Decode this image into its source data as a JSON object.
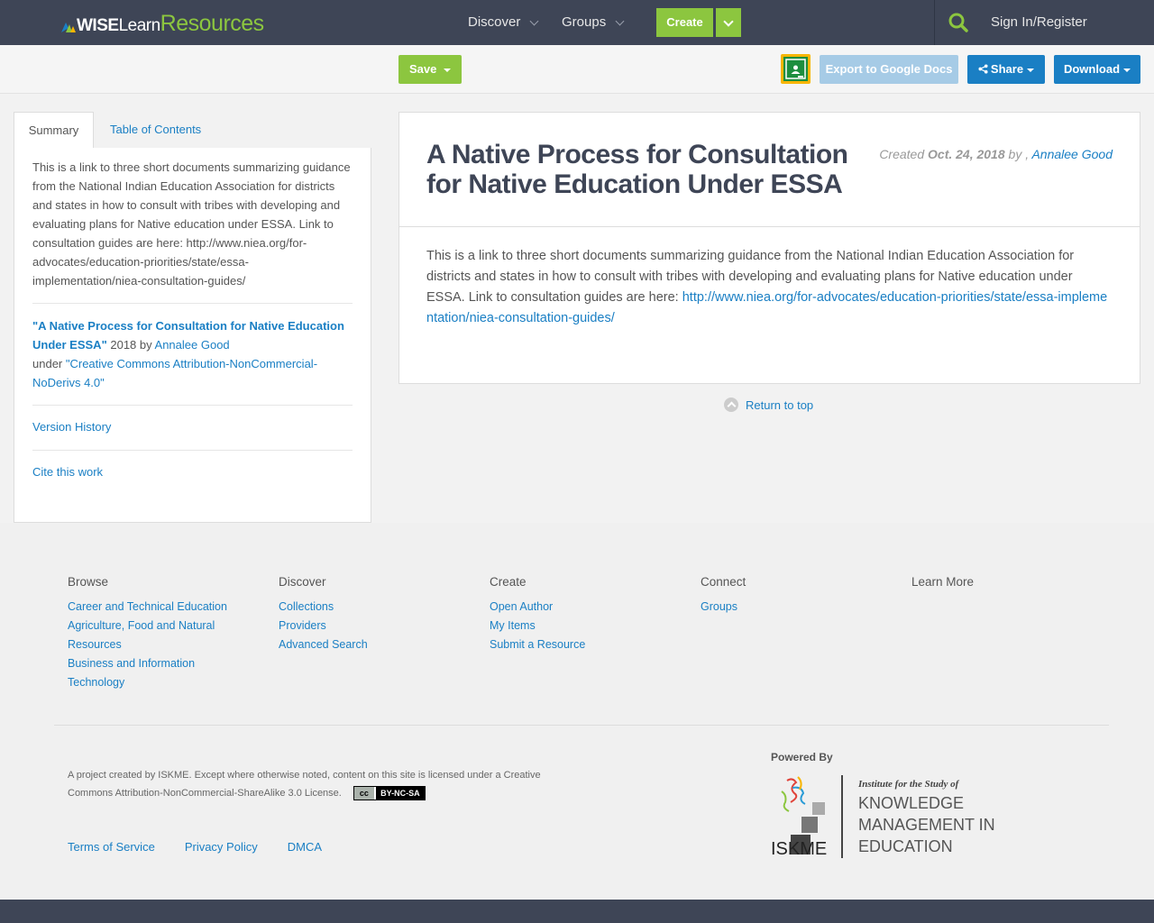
{
  "brand": {
    "wise": "WISE",
    "learn": "Learn",
    "resources": "Resources"
  },
  "nav": {
    "discover": "Discover",
    "groups": "Groups",
    "create": "Create",
    "sign_in": "Sign In/Register"
  },
  "actions": {
    "save": "Save",
    "export": "Export to Google Docs",
    "share": "Share",
    "download": "Download"
  },
  "sidebar": {
    "tabs": [
      "Summary",
      "Table of Contents"
    ],
    "summary": "This is a link to three short documents summarizing guidance from the National Indian Education Association for districts and states in how to consult with tribes with developing and evaluating plans for Native education under ESSA. Link to consultation guides are here: http://www.niea.org/for-advocates/education-priorities/state/essa-implementation/niea-consultation-guides/",
    "attribution": {
      "title": "\"A Native Process for Consultation for Native Education Under ESSA\"",
      "year_by": " 2018 by ",
      "author": "Annalee Good",
      "under": "under ",
      "license": "\"Creative Commons Attribution-NonCommercial-NoDerivs 4.0\""
    },
    "version_history": "Version History",
    "cite": "Cite this work"
  },
  "main": {
    "title": "A Native Process for Consultation for Native Education Under ESSA",
    "created_label": "Created ",
    "created_date": "Oct. 24, 2018",
    "by": " by , ",
    "author": "Annalee Good",
    "body_text": "This is a link to three short documents summarizing guidance from the National Indian Education Association for districts and states in how to consult with tribes with developing and evaluating plans for Native education under ESSA. Link to consultation guides are here: ",
    "body_link": "http://www.niea.org/for-advocates/education-priorities/state/essa-implementation/niea-consultation-guides/",
    "return_to_top": "Return to top"
  },
  "footer": {
    "columns": [
      {
        "heading": "Browse",
        "links": [
          "Career and Technical Education",
          "Agriculture, Food and Natural Resources",
          "Business and Information Technology"
        ]
      },
      {
        "heading": "Discover",
        "links": [
          "Collections",
          "Providers",
          "Advanced Search"
        ]
      },
      {
        "heading": "Create",
        "links": [
          "Open Author",
          "My Items",
          "Submit a Resource"
        ]
      },
      {
        "heading": "Connect",
        "links": [
          "Groups"
        ]
      },
      {
        "heading": "Learn More",
        "links": []
      }
    ],
    "license_text": "A project created by ISKME. Except where otherwise noted, content on this site is licensed under a Creative Commons Attribution-NonCommercial-ShareAlike 3.0 License.",
    "badge": {
      "cc": "cc",
      "text": "BY-NC-SA"
    },
    "links": [
      "Terms of Service",
      "Privacy Policy",
      "DMCA"
    ],
    "powered_by": "Powered By",
    "iskme": {
      "institute": "Institute for the Study of",
      "line1": "KNOWLEDGE",
      "line2": "MANAGEMENT IN",
      "line3": "EDUCATION",
      "abbr": "ISKME"
    }
  },
  "colors": {
    "nav_bg": "#3e4556",
    "green": "#8cc63f",
    "blue": "#1a7fc4",
    "export_blue": "#a6cbe6"
  }
}
